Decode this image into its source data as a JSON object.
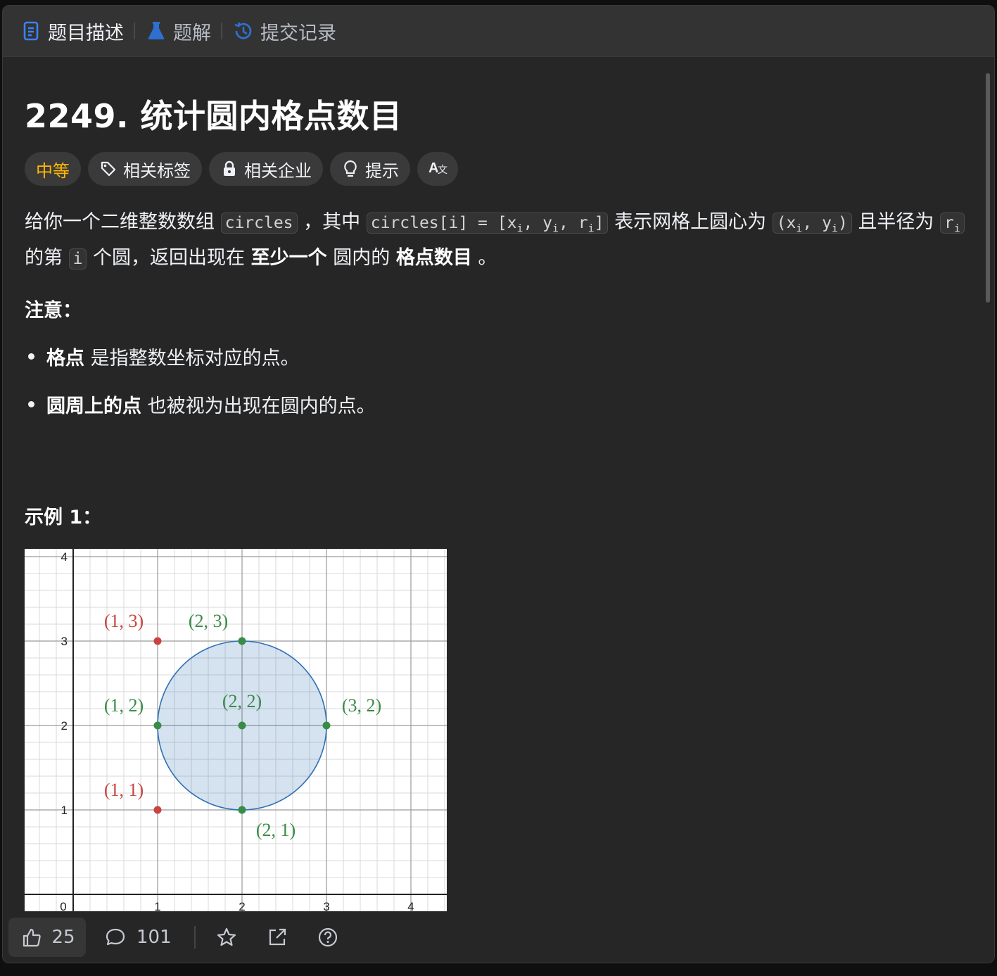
{
  "tabs": [
    {
      "label": "题目描述",
      "icon": "document-icon"
    },
    {
      "label": "题解",
      "icon": "flask-icon"
    },
    {
      "label": "提交记录",
      "icon": "history-icon"
    }
  ],
  "problem": {
    "title": "2249. 统计圆内格点数目",
    "difficulty": "中等",
    "chips": [
      "相关标签",
      "相关企业",
      "提示"
    ],
    "translate_icon": "translate-icon",
    "desc": {
      "t1": "给你一个二维整数数组",
      "c1": "circles",
      "t2": "，其中",
      "c2a": "circles[i] = [x",
      "c2s1": "i",
      "c2b": ", y",
      "c2s2": "i",
      "c2c": ", r",
      "c2s3": "i",
      "c2d": "]",
      "t3": "表示网格上圆心为",
      "c3a": "(x",
      "c3s1": "i",
      "c3b": ", y",
      "c3s2": "i",
      "c3c": ")",
      "t4": "且半径为",
      "c4a": "r",
      "c4s": "i",
      "t5": "的第",
      "c5": "i",
      "t6": "个圆，返回出现在",
      "b1": "至少一个",
      "t7": "圆内的",
      "b2": "格点数目",
      "t8": "。"
    },
    "note_title": "注意：",
    "bullets": [
      {
        "bold": "格点",
        "text": "是指整数坐标对应的点。"
      },
      {
        "bold": "圆周上的点",
        "text": "也被视为出现在圆内的点。"
      }
    ],
    "example_title": "示例 1："
  },
  "figure": {
    "x_ticks": [
      "0",
      "1",
      "2",
      "3",
      "4"
    ],
    "y_ticks": [
      "1",
      "2",
      "3",
      "4"
    ],
    "points": [
      {
        "label": "(1, 3)",
        "color": "#c74440"
      },
      {
        "label": "(2, 3)",
        "color": "#388c46"
      },
      {
        "label": "(1, 2)",
        "color": "#388c46"
      },
      {
        "label": "(2, 2)",
        "color": "#388c46"
      },
      {
        "label": "(3, 2)",
        "color": "#388c46"
      },
      {
        "label": "(1, 1)",
        "color": "#c74440"
      },
      {
        "label": "(2, 1)",
        "color": "#388c46"
      }
    ],
    "circle_center": [
      2,
      2
    ],
    "circle_radius": 1,
    "circle_color": "#2d70b3"
  },
  "bottom": {
    "likes": "25",
    "comments": "101"
  }
}
